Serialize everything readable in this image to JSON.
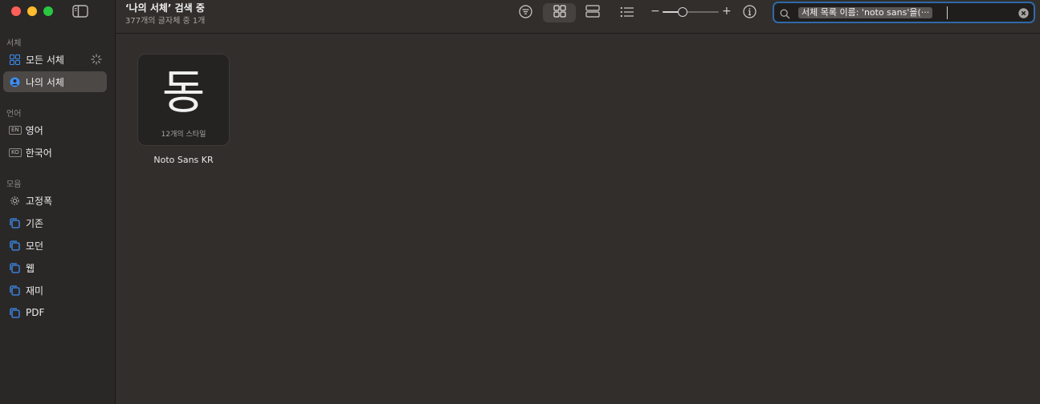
{
  "window": {
    "title": "‘나의 서체’ 검색 중",
    "subtitle": "377개의 글자체 중 1개"
  },
  "sidebar": {
    "sections": [
      {
        "title": "서체",
        "items": [
          {
            "label": "모든 서체",
            "icon": "grid-icon"
          },
          {
            "label": "나의 서체",
            "icon": "person-circle-icon",
            "active": true
          }
        ]
      },
      {
        "title": "언어",
        "items": [
          {
            "label": "영어",
            "badge": "EN"
          },
          {
            "label": "한국어",
            "badge": "KO"
          }
        ]
      },
      {
        "title": "모음",
        "items": [
          {
            "label": "고정폭",
            "icon": "gear-icon"
          },
          {
            "label": "기존",
            "icon": "collection-icon"
          },
          {
            "label": "모던",
            "icon": "collection-icon"
          },
          {
            "label": "웹",
            "icon": "collection-icon"
          },
          {
            "label": "재미",
            "icon": "collection-icon"
          },
          {
            "label": "PDF",
            "icon": "collection-icon"
          }
        ]
      }
    ]
  },
  "search": {
    "token": "서체 목록 이름: 'noto sans'을(···"
  },
  "fonts": [
    {
      "preview_glyph": "동",
      "styles_label": "12개의 스타일",
      "name": "Noto Sans KR"
    }
  ],
  "toolbar": {
    "minus": "−",
    "plus": "+",
    "zoom_level": 0.4
  },
  "colors": {
    "accent": "#2f6aa8",
    "collection_icon": "#3d8ef5"
  }
}
